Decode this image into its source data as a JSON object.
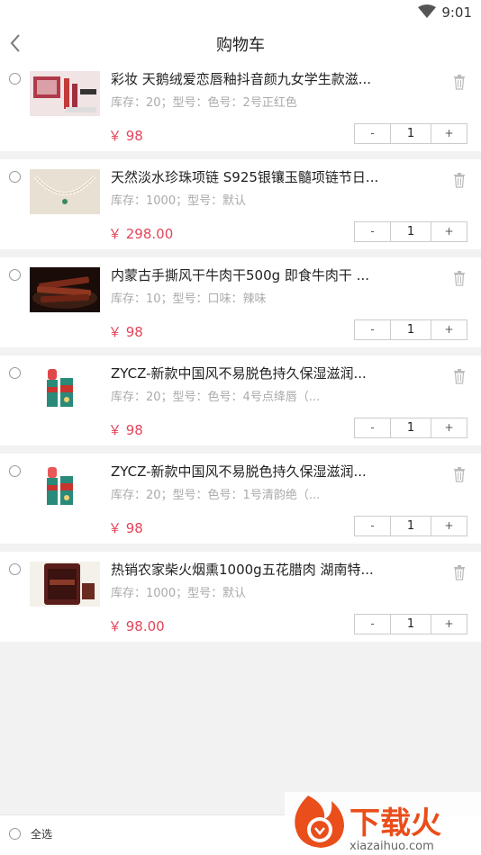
{
  "status_bar": {
    "time": "9:01"
  },
  "header": {
    "title": "购物车"
  },
  "cart_items": [
    {
      "name": "彩妆 天鹅绒爱恋唇釉抖音颜九女学生款滋...",
      "spec": "库存：20；型号：色号：2号正红色",
      "price": "￥ 98",
      "quantity": "1",
      "thumb": "makeup-set-image"
    },
    {
      "name": "天然淡水珍珠项链 S925银镶玉髓项链节日...",
      "spec": "库存：1000；型号：默认",
      "price": "￥ 298.00",
      "quantity": "1",
      "thumb": "pearl-necklace-image"
    },
    {
      "name": "内蒙古手撕风干牛肉干500g 即食牛肉干 ...",
      "spec": "库存：10；型号：口味：辣味",
      "price": "￥ 98",
      "quantity": "1",
      "thumb": "beef-jerky-image"
    },
    {
      "name": "ZYCZ-新款中国风不易脱色持久保湿滋润...",
      "spec": "库存：20；型号：色号：4号点绛唇（...",
      "price": "￥ 98",
      "quantity": "1",
      "thumb": "lipstick-image"
    },
    {
      "name": "ZYCZ-新款中国风不易脱色持久保湿滋润...",
      "spec": "库存：20；型号：色号：1号清韵绝（...",
      "price": "￥ 98",
      "quantity": "1",
      "thumb": "lipstick-image"
    },
    {
      "name": "热销农家柴火烟熏1000g五花腊肉 湖南特...",
      "spec": "库存：1000；型号：默认",
      "price": "￥ 98.00",
      "quantity": "1",
      "thumb": "smoked-pork-image"
    }
  ],
  "stepper": {
    "minus": "-",
    "plus": "+"
  },
  "footer": {
    "select_all": "全选"
  },
  "watermark": {
    "brand": "下载火",
    "url": "xiazaihuo.com"
  },
  "colors": {
    "price": "#e3455a",
    "watermark": "#e94e1b"
  }
}
